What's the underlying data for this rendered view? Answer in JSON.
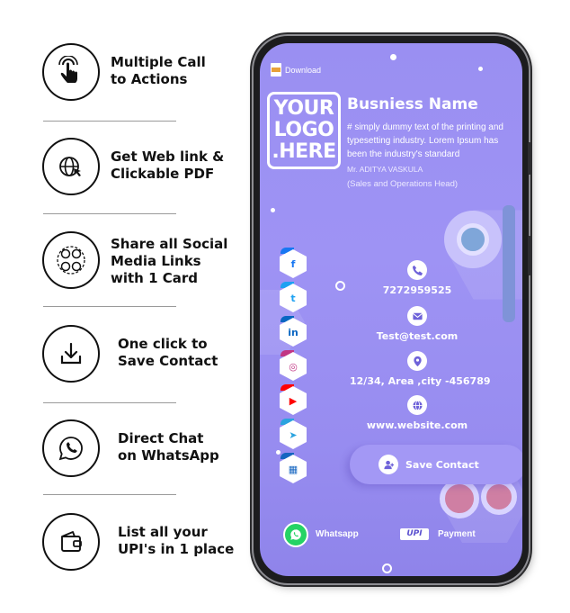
{
  "features": [
    {
      "icon": "touch-hand-icon",
      "lines": [
        "Multiple Call",
        "to Actions"
      ]
    },
    {
      "icon": "globe-cursor-icon",
      "lines": [
        "Get Web link &",
        "Clickable PDF"
      ]
    },
    {
      "icon": "social-media-icon",
      "lines": [
        "Share all Social",
        "Media Links",
        "with 1 Card"
      ]
    },
    {
      "icon": "download-icon",
      "lines": [
        "One click to",
        "Save Contact"
      ]
    },
    {
      "icon": "whatsapp-icon",
      "lines": [
        "Direct Chat",
        "on WhatsApp"
      ]
    },
    {
      "icon": "wallet-icon",
      "lines": [
        "List all your",
        "UPI's in 1 place"
      ]
    }
  ],
  "card": {
    "download_label": "Download",
    "logo_lines": [
      "YOUR",
      "LOGO",
      ".HERE"
    ],
    "business_name": "Busniess Name",
    "description": "# simply dummy text of the printing and typesetting industry. Lorem Ipsum has been the industry's standard",
    "owner": "Mr. ADITYA VASKULA",
    "role": "(Sales and Operations Head)",
    "socials": [
      {
        "name": "facebook",
        "glyph": "f",
        "color": "#1877f2"
      },
      {
        "name": "twitter",
        "glyph": "t",
        "color": "#1da1f2"
      },
      {
        "name": "linkedin",
        "glyph": "in",
        "color": "#0a66c2"
      },
      {
        "name": "instagram",
        "glyph": "◎",
        "color": "#c13584"
      },
      {
        "name": "youtube",
        "glyph": "▶",
        "color": "#ff0000"
      },
      {
        "name": "telegram",
        "glyph": "➤",
        "color": "#2aa3df"
      },
      {
        "name": "store",
        "glyph": "▦",
        "color": "#1565c0"
      }
    ],
    "phone": "7272959525",
    "email": "Test@test.com",
    "address": "12/34, Area ,city -456789",
    "website": "www.website.com",
    "save_contact_label": "Save Contact",
    "whatsapp_label": "Whatsapp",
    "upi_badge": "UPI",
    "payment_label": "Payment",
    "accent_color": "#6e62d9"
  }
}
